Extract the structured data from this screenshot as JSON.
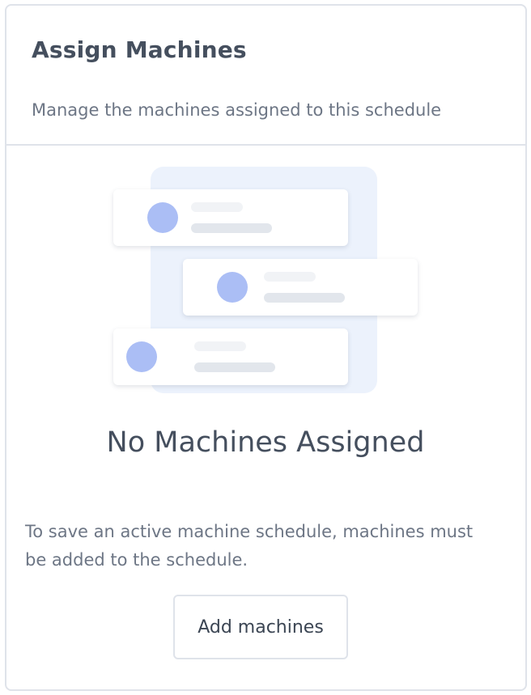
{
  "header": {
    "title": "Assign Machines",
    "subtitle": "Manage the machines assigned to this schedule"
  },
  "empty_state": {
    "illustration_icon": "machine-list-illustration",
    "title": "No Machines Assigned",
    "description": "To save an active machine schedule, machines must be added to the schedule."
  },
  "actions": {
    "add_label": "Add machines"
  },
  "colors": {
    "text_primary": "#454f5e",
    "text_secondary": "#6d7685",
    "border": "#dfe3ea",
    "illustration_bg": "#ecf2fc",
    "illustration_dot": "#abbef5"
  }
}
